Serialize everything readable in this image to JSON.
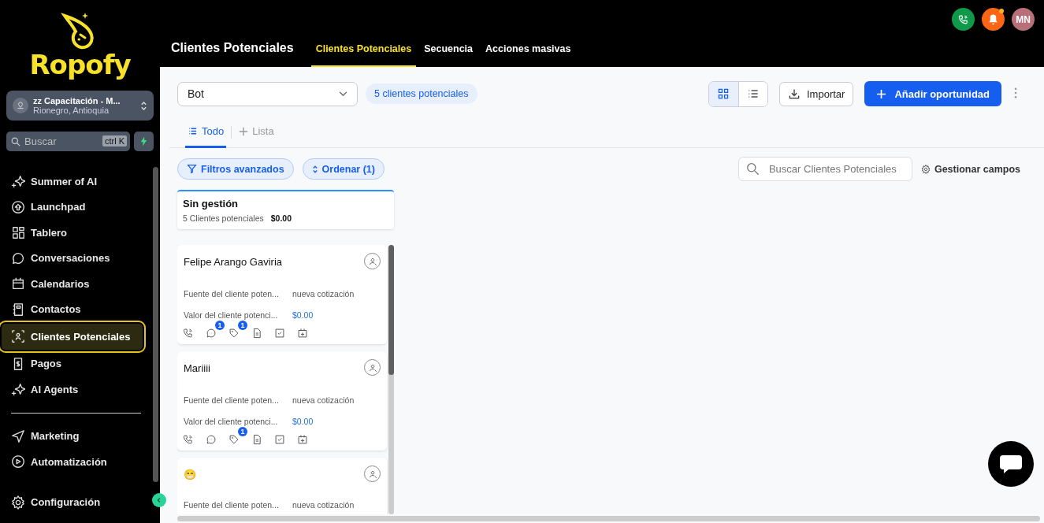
{
  "brand": {
    "name": "Ropofy"
  },
  "workspace": {
    "name": "zz Capacitación - M...",
    "location": "Rionegro, Antioquia"
  },
  "sidebar_search": {
    "placeholder": "Buscar",
    "shortcut": "ctrl K"
  },
  "sidebar": {
    "items": [
      {
        "label": "Summer of AI",
        "selected": false
      },
      {
        "label": "Launchpad",
        "selected": false
      },
      {
        "label": "Tablero",
        "selected": false
      },
      {
        "label": "Conversaciones",
        "selected": false
      },
      {
        "label": "Calendarios",
        "selected": false
      },
      {
        "label": "Contactos",
        "selected": false
      },
      {
        "label": "Clientes Potenciales",
        "selected": true
      },
      {
        "label": "Pagos",
        "selected": false
      },
      {
        "label": "AI Agents",
        "selected": false
      }
    ],
    "secondary_items": [
      {
        "label": "Marketing",
        "selected": false
      },
      {
        "label": "Automatización",
        "selected": false
      }
    ],
    "settings": {
      "label": "Configuración",
      "selected": false
    }
  },
  "header": {
    "title": "Clientes Potenciales",
    "tabs": [
      {
        "label": "Clientes Potenciales",
        "selected": true
      },
      {
        "label": "Secuencia",
        "selected": false
      },
      {
        "label": "Acciones masivas",
        "selected": false
      }
    ],
    "avatar": "MN",
    "notification_dot": true
  },
  "toolbar": {
    "pipeline": "Bot",
    "count_badge": "5 clientes potenciales",
    "view_modes": [
      {
        "kind": "grid",
        "selected": true
      },
      {
        "kind": "list",
        "selected": false
      }
    ],
    "import_button": "Importar",
    "add_button": "Añadir oportunidad"
  },
  "view_tabs": [
    {
      "label": "Todo",
      "kind": "list",
      "selected": true
    },
    {
      "label": "Lista",
      "kind": "add",
      "selected": false
    }
  ],
  "filters": {
    "advanced": "Filtros avanzados",
    "sort": "Ordenar (1)",
    "search_placeholder": "Buscar Clientes Potenciales",
    "manage_fields": "Gestionar campos"
  },
  "stage": {
    "name": "Sin gestión",
    "count": "5 Clientes potenciales",
    "total": "$0.00"
  },
  "cards": [
    {
      "name": "Felipe Arango Gaviria",
      "fields": [
        {
          "label": "Fuente del cliente poten...",
          "value": "nueva cotización"
        },
        {
          "label": "Valor del cliente potenci...",
          "value": "$0.00"
        }
      ],
      "actions": [
        {
          "kind": "phone"
        },
        {
          "kind": "chat",
          "badge": "1"
        },
        {
          "kind": "tag",
          "badge": "1"
        },
        {
          "kind": "note"
        },
        {
          "kind": "task"
        },
        {
          "kind": "appointment"
        }
      ]
    },
    {
      "name": "Mariiii",
      "fields": [
        {
          "label": "Fuente del cliente poten...",
          "value": "nueva cotización"
        },
        {
          "label": "Valor del cliente potenci...",
          "value": "$0.00"
        }
      ],
      "actions": [
        {
          "kind": "phone"
        },
        {
          "kind": "chat"
        },
        {
          "kind": "tag",
          "badge": "1"
        },
        {
          "kind": "note"
        },
        {
          "kind": "task"
        },
        {
          "kind": "appointment"
        }
      ]
    },
    {
      "name": "😁",
      "fields": [
        {
          "label": "Fuente del cliente poten...",
          "value": "nueva cotización"
        }
      ]
    }
  ]
}
